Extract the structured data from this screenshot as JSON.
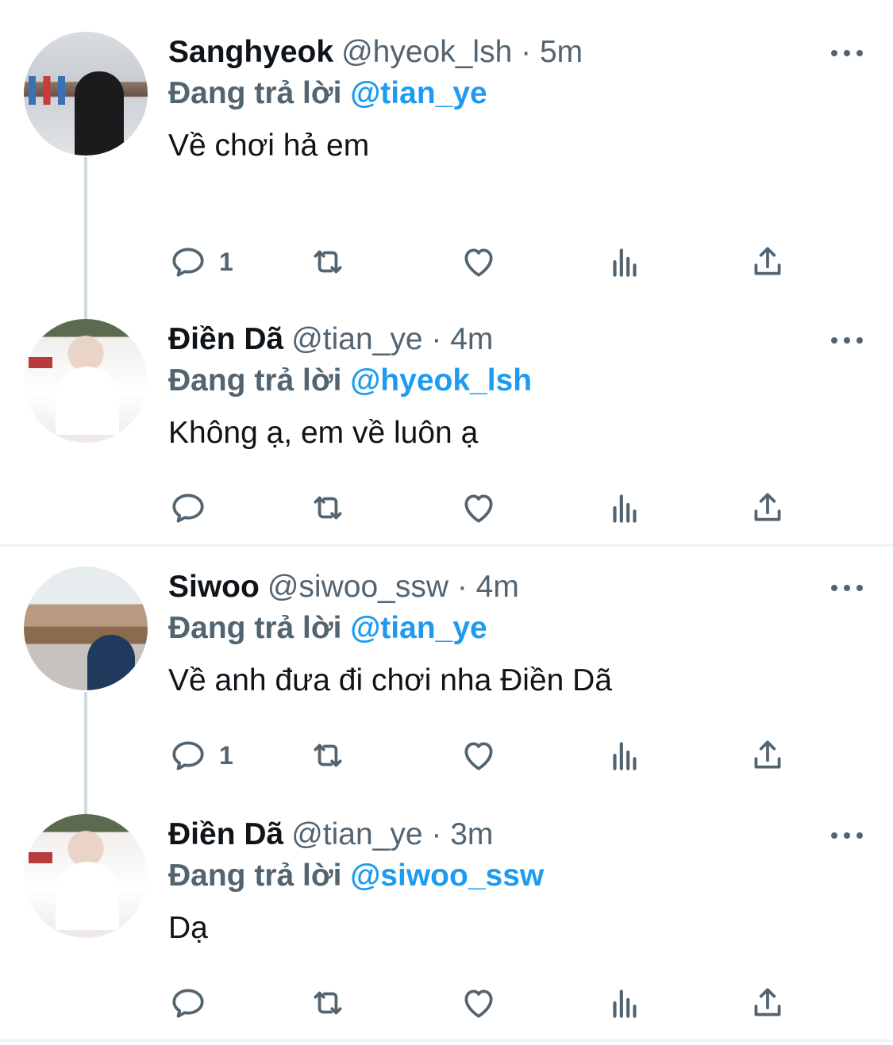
{
  "reply_prefix": "Đang trả lời",
  "tweets": [
    {
      "name": "Sanghyeok",
      "handle": "@hyeok_lsh",
      "time": "5m",
      "meta": "@hyeok_lsh · 5m",
      "replying_to": "@tian_ye",
      "text": "Về chơi hả em",
      "reply_count": "1"
    },
    {
      "name": "Điền Dã",
      "handle": "@tian_ye",
      "time": "4m",
      "meta": "@tian_ye · 4m",
      "replying_to": "@hyeok_lsh",
      "text": "Không ạ, em về luôn ạ",
      "reply_count": ""
    },
    {
      "name": "Siwoo",
      "handle": "@siwoo_ssw",
      "time": "4m",
      "meta": "@siwoo_ssw · 4m",
      "replying_to": "@tian_ye",
      "text": "Về anh đưa đi chơi nha Điền Dã",
      "reply_count": "1"
    },
    {
      "name": "Điền Dã",
      "handle": "@tian_ye",
      "time": "3m",
      "meta": "@tian_ye · 3m",
      "replying_to": "@siwoo_ssw",
      "text": "Dạ",
      "reply_count": ""
    }
  ],
  "icons": [
    "reply-icon",
    "retweet-icon",
    "like-icon",
    "views-icon",
    "share-icon",
    "more-icon"
  ],
  "colors": {
    "accent": "#1d9bf0",
    "muted": "#536471",
    "text": "#0f1419",
    "thread_line": "#cfd9de"
  }
}
